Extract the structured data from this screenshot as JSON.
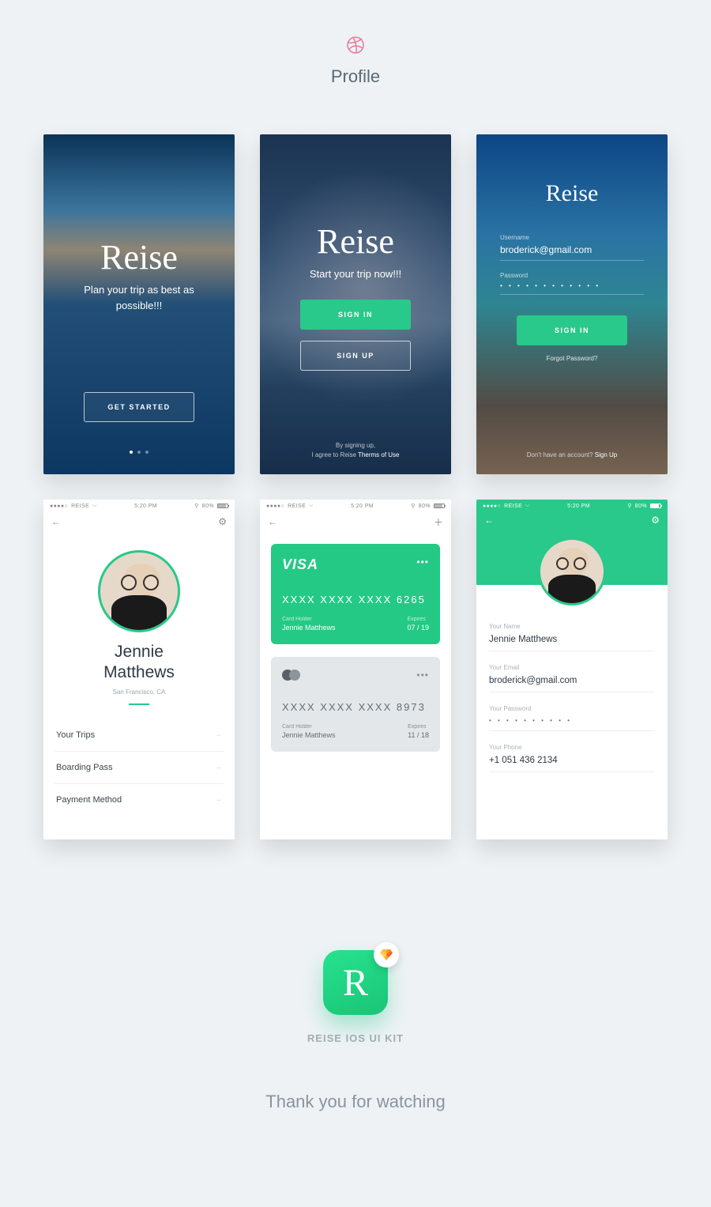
{
  "header": {
    "title": "Profile"
  },
  "status": {
    "carrier": "REISE",
    "time": "5:20 PM",
    "battery": "80%"
  },
  "onboard": {
    "brand": "Reise",
    "tagline": "Plan your trip as best as possible!!!",
    "cta": "GET STARTED"
  },
  "intro": {
    "brand": "Reise",
    "subtitle": "Start your trip now!!!",
    "signin": "SIGN IN",
    "signup": "SIGN UP",
    "terms_line1": "By signing up,",
    "terms_line2_prefix": "I agree to Reise ",
    "terms_link": "Therms of Use"
  },
  "login": {
    "brand": "Reise",
    "username_label": "Username",
    "username_value": "broderick@gmail.com",
    "password_label": "Password",
    "password_mask": "• • • • • • • • • • • •",
    "signin": "SIGN IN",
    "forgot": "Forgot Password?",
    "noacct_prefix": "Don't have an account? ",
    "noacct_link": "Sign Up"
  },
  "profile": {
    "name": "Jennie Matthews",
    "location": "San Francisco, CA",
    "menu": [
      "Your Trips",
      "Boarding Pass",
      "Payment Method"
    ]
  },
  "cards": {
    "visa": {
      "brand": "VISA",
      "number": "XXXX  XXXX  XXXX  6265",
      "holder_label": "Card Holder",
      "holder": "Jennie Matthews",
      "exp_label": "Expires",
      "exp": "07 / 19"
    },
    "mc": {
      "number": "XXXX  XXXX  XXXX  8973",
      "holder_label": "Card Holder",
      "holder": "Jennie Matthews",
      "exp_label": "Expires",
      "exp": "11 / 18"
    }
  },
  "edit": {
    "name_label": "Your Name",
    "name": "Jennie Matthews",
    "email_label": "Your Email",
    "email": "broderick@gmail.com",
    "pw_label": "Your Password",
    "pw": "• • • • • • • • • •",
    "phone_label": "Your Phone",
    "phone": "+1 051 436 2134"
  },
  "footer": {
    "kit": "REISE IOS UI KIT",
    "thanks": "Thank you for watching"
  }
}
